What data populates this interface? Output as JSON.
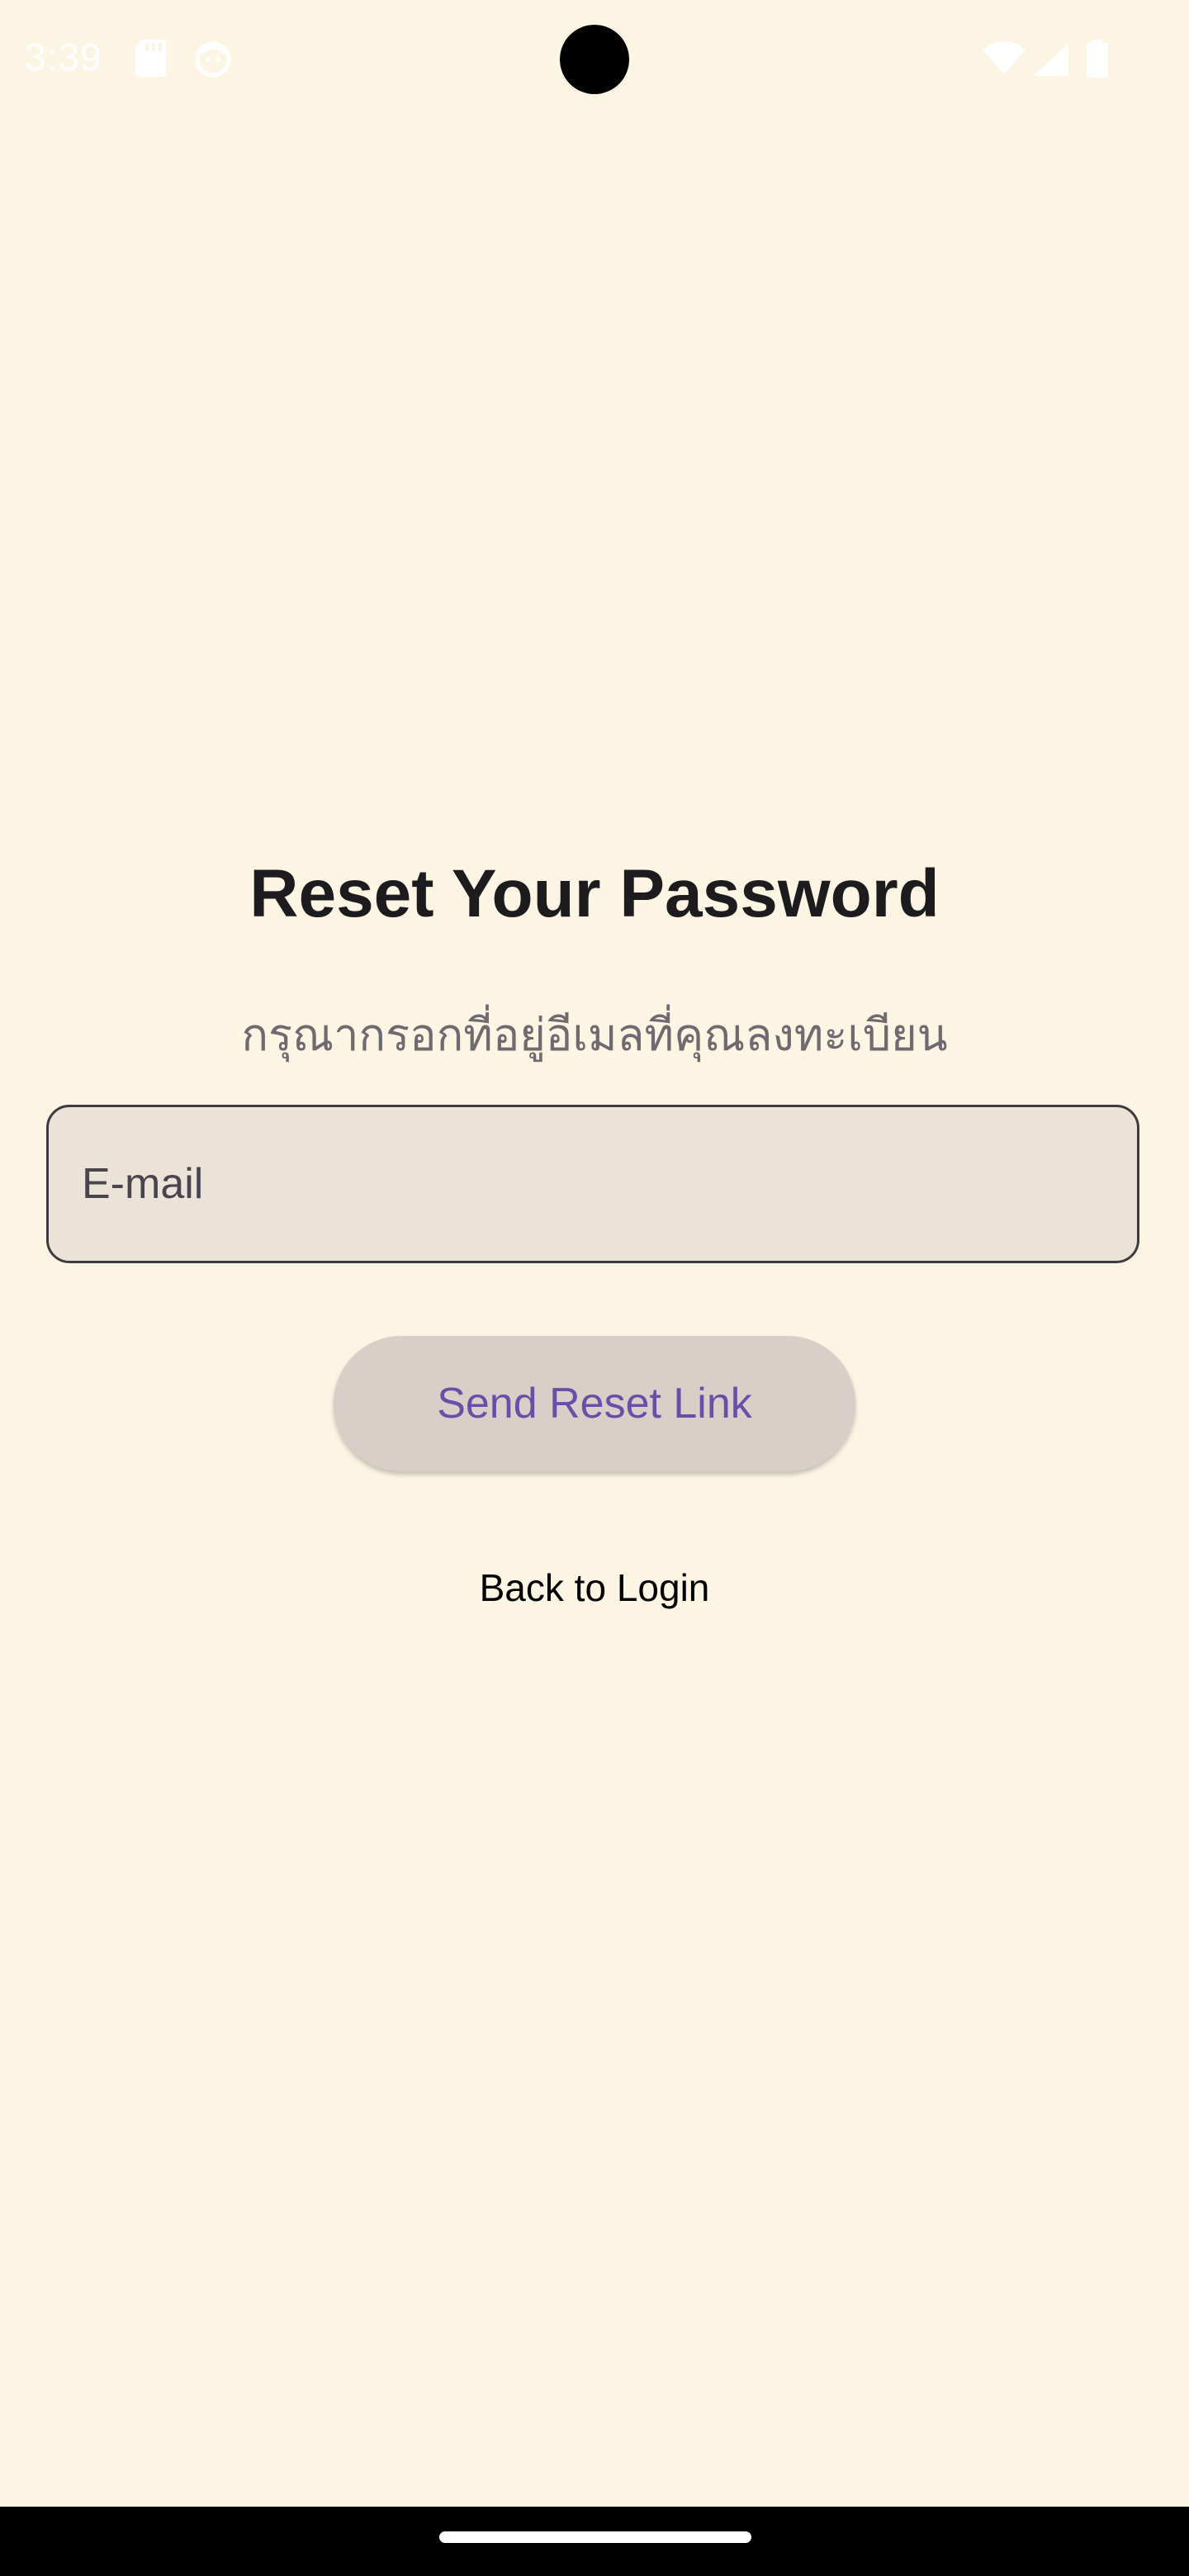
{
  "status_bar": {
    "time": "3:39",
    "left_icons": [
      "sd-card-icon",
      "face-notification-icon"
    ],
    "right_icons": [
      "wifi-icon",
      "cellular-signal-icon",
      "battery-icon"
    ]
  },
  "reset": {
    "title": "Reset Your Password",
    "subtitle": "กรุณากรอกที่อยู่อีเมลที่คุณลงทะเบียน",
    "email_placeholder": "E-mail",
    "email_value": "",
    "send_button_label": "Send Reset Link",
    "back_link_label": "Back to Login"
  },
  "colors": {
    "background": "#fcf5e4",
    "field_background": "#ebe3d7",
    "button_background": "#d9cec8",
    "button_text": "#6a4fa6"
  }
}
